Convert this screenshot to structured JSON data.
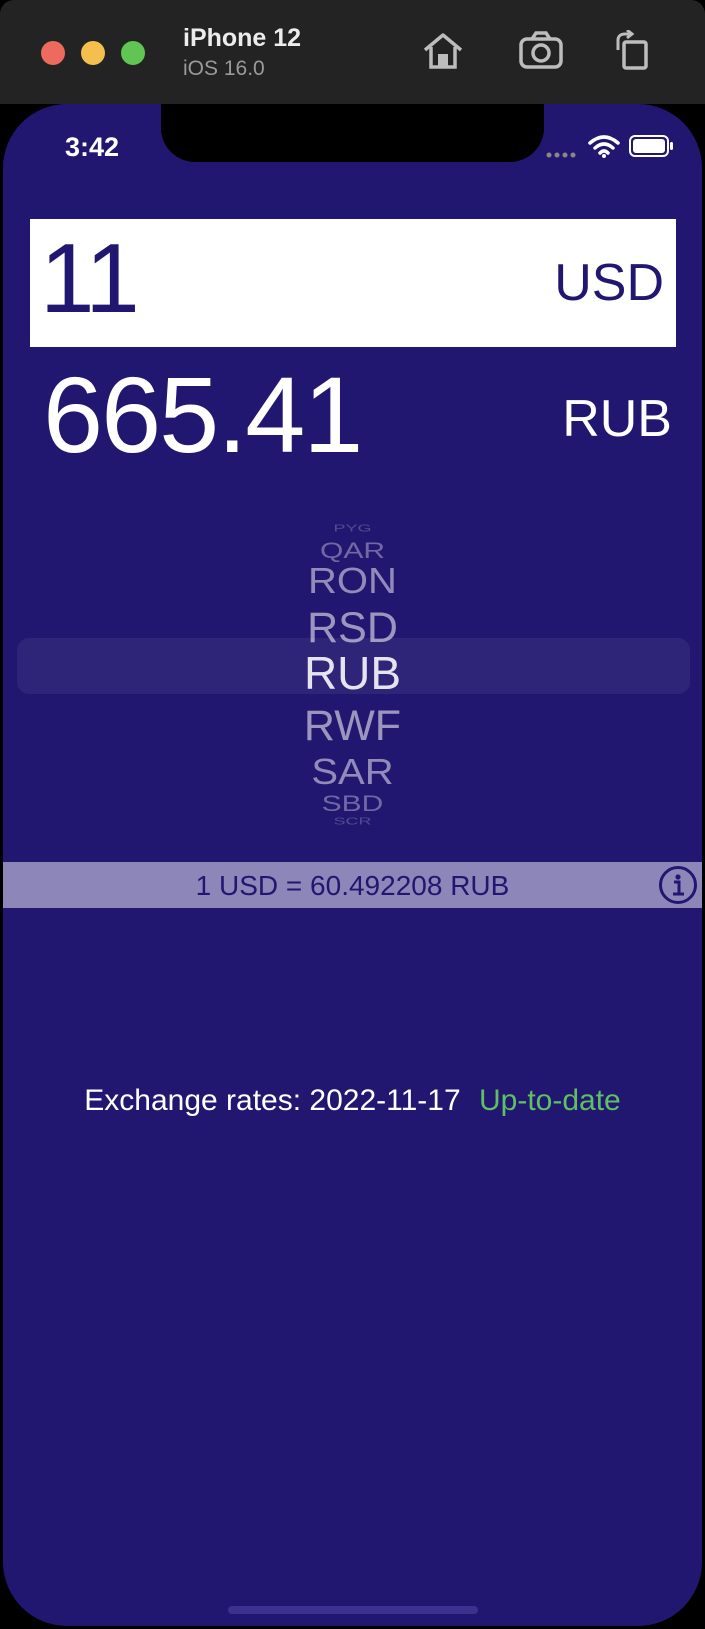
{
  "simulator": {
    "device_name": "iPhone 12",
    "os_version": "iOS 16.0",
    "traffic_lights": {
      "close": "#ed6a5e",
      "minimize": "#f5bf4f",
      "zoom": "#61c554"
    },
    "toolbar_icons": [
      "home-icon",
      "screenshot-icon",
      "rotate-icon"
    ]
  },
  "status_bar": {
    "time": "3:42",
    "icons": [
      "signal-dots-icon",
      "wifi-icon",
      "battery-icon"
    ]
  },
  "converter": {
    "input_amount": "11",
    "input_currency": "USD",
    "result_amount": "665.41",
    "result_currency": "RUB"
  },
  "picker": {
    "items": [
      "PYG",
      "QAR",
      "RON",
      "RSD",
      "RUB",
      "RWF",
      "SAR",
      "SBD",
      "SCR"
    ],
    "selected": "RUB"
  },
  "rate_bar": {
    "text": "1 USD = 60.492208 RUB",
    "icon": "info-icon"
  },
  "footer": {
    "label": "Exchange rates: 2022-11-17",
    "status": "Up-to-date"
  },
  "colors": {
    "background": "#211770",
    "input_bg": "#ffffff",
    "rate_bar": "#8d86b9",
    "status_ok": "#5fbf62"
  }
}
